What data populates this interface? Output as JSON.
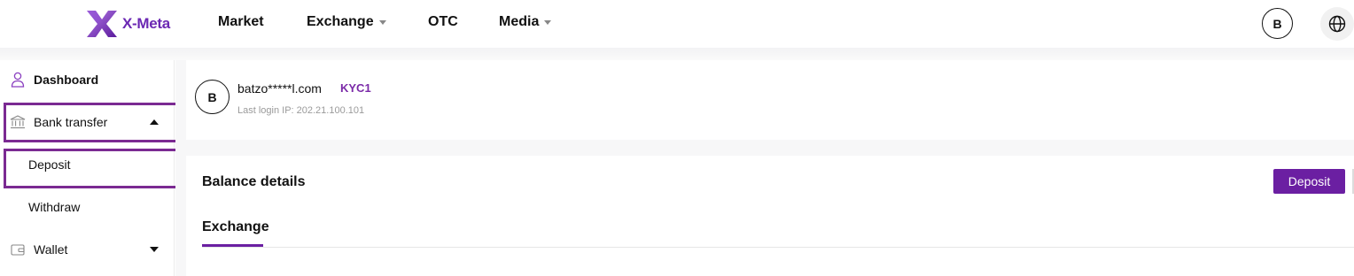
{
  "brand": {
    "name": "X-Meta",
    "color": "#6b28b3"
  },
  "nav": {
    "market": "Market",
    "exchange": "Exchange",
    "otc": "OTC",
    "media": "Media"
  },
  "user": {
    "initial": "B"
  },
  "icons": {
    "globe": "globe-icon"
  },
  "sidebar": {
    "dashboard": "Dashboard",
    "bank_transfer": "Bank transfer",
    "deposit": "Deposit",
    "withdraw": "Withdraw",
    "wallet": "Wallet"
  },
  "profile": {
    "initial": "B",
    "email": "batzo*****l.com",
    "kyc": "KYC1",
    "last_login": "Last login IP: 202.21.100.101"
  },
  "balance": {
    "title": "Balance details",
    "deposit_button": "Deposit",
    "tabs": [
      "Exchange"
    ]
  },
  "colors": {
    "accent": "#6b1fa2",
    "highlight": "#7b2a92"
  }
}
